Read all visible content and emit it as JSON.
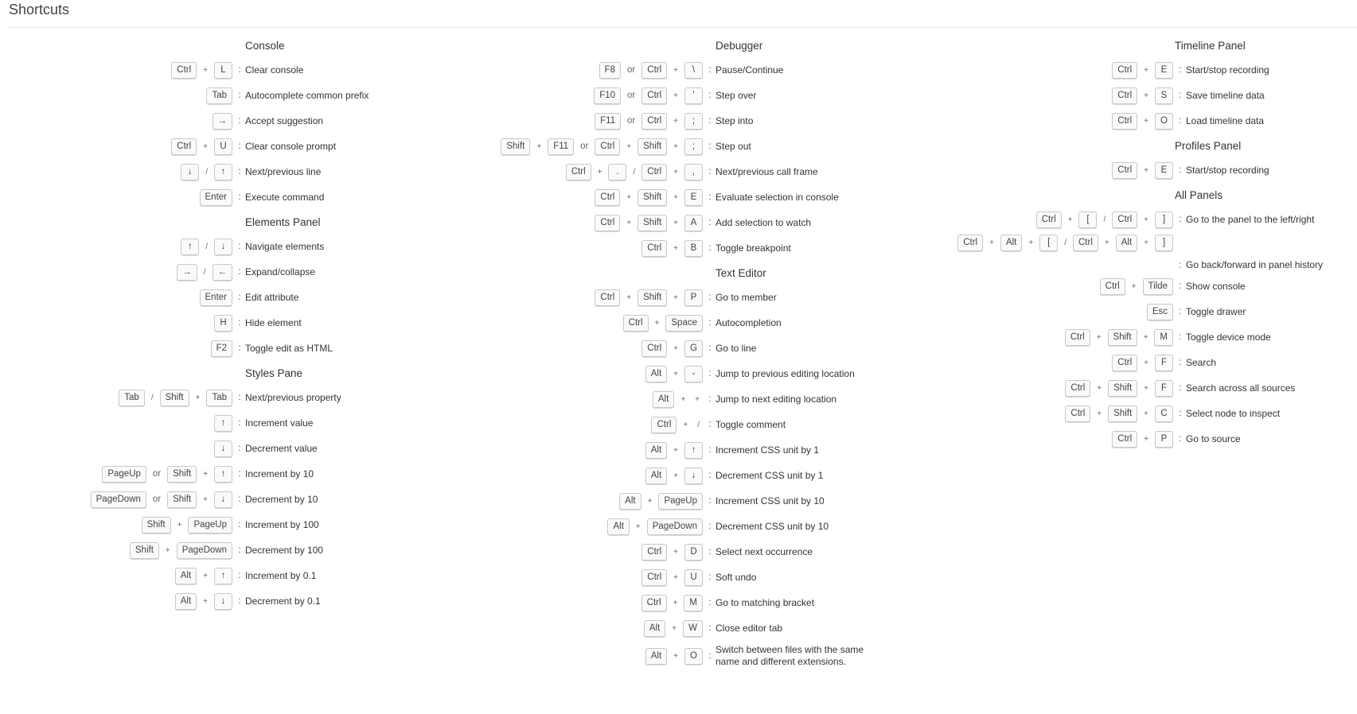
{
  "title": "Shortcuts",
  "columns": [
    {
      "sections": [
        {
          "title": "Console",
          "rows": [
            {
              "keys": [
                [
                  "Ctrl",
                  "+",
                  "L"
                ]
              ],
              "desc": "Clear console"
            },
            {
              "keys": [
                [
                  "Tab"
                ]
              ],
              "desc": "Autocomplete common prefix"
            },
            {
              "keys": [
                [
                  "→"
                ]
              ],
              "desc": "Accept suggestion"
            },
            {
              "keys": [
                [
                  "Ctrl",
                  "+",
                  "U"
                ]
              ],
              "desc": "Clear console prompt"
            },
            {
              "keys": [
                [
                  "↓",
                  "/",
                  "↑"
                ]
              ],
              "desc": "Next/previous line"
            },
            {
              "keys": [
                [
                  "Enter"
                ]
              ],
              "desc": "Execute command"
            }
          ]
        },
        {
          "title": "Elements Panel",
          "rows": [
            {
              "keys": [
                [
                  "↑",
                  "/",
                  "↓"
                ]
              ],
              "desc": "Navigate elements"
            },
            {
              "keys": [
                [
                  "→",
                  "/",
                  "←"
                ]
              ],
              "desc": "Expand/collapse"
            },
            {
              "keys": [
                [
                  "Enter"
                ]
              ],
              "desc": "Edit attribute"
            },
            {
              "keys": [
                [
                  "H"
                ]
              ],
              "desc": "Hide element"
            },
            {
              "keys": [
                [
                  "F2"
                ]
              ],
              "desc": "Toggle edit as HTML"
            }
          ]
        },
        {
          "title": "Styles Pane",
          "rows": [
            {
              "keys": [
                [
                  "Tab",
                  "/",
                  "Shift",
                  "+",
                  "Tab"
                ]
              ],
              "desc": "Next/previous property"
            },
            {
              "keys": [
                [
                  "↑"
                ]
              ],
              "desc": "Increment value"
            },
            {
              "keys": [
                [
                  "↓"
                ]
              ],
              "desc": "Decrement value"
            },
            {
              "keys": [
                [
                  "PageUp"
                ],
                [
                  "Shift",
                  "+",
                  "↑"
                ]
              ],
              "desc": "Increment by 10"
            },
            {
              "keys": [
                [
                  "PageDown"
                ],
                [
                  "Shift",
                  "+",
                  "↓"
                ]
              ],
              "desc": "Decrement by 10"
            },
            {
              "keys": [
                [
                  "Shift",
                  "+",
                  "PageUp"
                ]
              ],
              "desc": "Increment by 100"
            },
            {
              "keys": [
                [
                  "Shift",
                  "+",
                  "PageDown"
                ]
              ],
              "desc": "Decrement by 100"
            },
            {
              "keys": [
                [
                  "Alt",
                  "+",
                  "↑"
                ]
              ],
              "desc": "Increment by 0.1"
            },
            {
              "keys": [
                [
                  "Alt",
                  "+",
                  "↓"
                ]
              ],
              "desc": "Decrement by 0.1"
            }
          ]
        }
      ]
    },
    {
      "sections": [
        {
          "title": "Debugger",
          "rows": [
            {
              "keys": [
                [
                  "F8"
                ],
                [
                  "Ctrl",
                  "+",
                  "\\"
                ]
              ],
              "desc": "Pause/Continue"
            },
            {
              "keys": [
                [
                  "F10"
                ],
                [
                  "Ctrl",
                  "+",
                  "'"
                ]
              ],
              "desc": "Step over"
            },
            {
              "keys": [
                [
                  "F11"
                ],
                [
                  "Ctrl",
                  "+",
                  ";"
                ]
              ],
              "desc": "Step into"
            },
            {
              "keys": [
                [
                  "Shift",
                  "+",
                  "F11"
                ],
                [
                  "Ctrl",
                  "+",
                  "Shift",
                  "+",
                  ";"
                ]
              ],
              "desc": "Step out"
            },
            {
              "keys": [
                [
                  "Ctrl",
                  "+",
                  ".",
                  "/",
                  "Ctrl",
                  "+",
                  ","
                ]
              ],
              "desc": "Next/previous call frame"
            },
            {
              "keys": [
                [
                  "Ctrl",
                  "+",
                  "Shift",
                  "+",
                  "E"
                ]
              ],
              "desc": "Evaluate selection in console"
            },
            {
              "keys": [
                [
                  "Ctrl",
                  "+",
                  "Shift",
                  "+",
                  "A"
                ]
              ],
              "desc": "Add selection to watch"
            },
            {
              "keys": [
                [
                  "Ctrl",
                  "+",
                  "B"
                ]
              ],
              "desc": "Toggle breakpoint"
            }
          ]
        },
        {
          "title": "Text Editor",
          "rows": [
            {
              "keys": [
                [
                  "Ctrl",
                  "+",
                  "Shift",
                  "+",
                  "P"
                ]
              ],
              "desc": "Go to member"
            },
            {
              "keys": [
                [
                  "Ctrl",
                  "+",
                  "Space"
                ]
              ],
              "desc": "Autocompletion"
            },
            {
              "keys": [
                [
                  "Ctrl",
                  "+",
                  "G"
                ]
              ],
              "desc": "Go to line"
            },
            {
              "keys": [
                [
                  "Alt",
                  "+",
                  "-"
                ]
              ],
              "desc": "Jump to previous editing location"
            },
            {
              "keys": [
                [
                  "Alt",
                  "+",
                  "+"
                ]
              ],
              "desc": "Jump to next editing location"
            },
            {
              "keys": [
                [
                  "Ctrl",
                  "+",
                  "/"
                ]
              ],
              "desc": "Toggle comment"
            },
            {
              "keys": [
                [
                  "Alt",
                  "+",
                  "↑"
                ]
              ],
              "desc": "Increment CSS unit by 1"
            },
            {
              "keys": [
                [
                  "Alt",
                  "+",
                  "↓"
                ]
              ],
              "desc": "Decrement CSS unit by 1"
            },
            {
              "keys": [
                [
                  "Alt",
                  "+",
                  "PageUp"
                ]
              ],
              "desc": "Increment CSS unit by 10"
            },
            {
              "keys": [
                [
                  "Alt",
                  "+",
                  "PageDown"
                ]
              ],
              "desc": "Decrement CSS unit by 10"
            },
            {
              "keys": [
                [
                  "Ctrl",
                  "+",
                  "D"
                ]
              ],
              "desc": "Select next occurrence"
            },
            {
              "keys": [
                [
                  "Ctrl",
                  "+",
                  "U"
                ]
              ],
              "desc": "Soft undo"
            },
            {
              "keys": [
                [
                  "Ctrl",
                  "+",
                  "M"
                ]
              ],
              "desc": "Go to matching bracket"
            },
            {
              "keys": [
                [
                  "Alt",
                  "+",
                  "W"
                ]
              ],
              "desc": "Close editor tab"
            },
            {
              "keys": [
                [
                  "Alt",
                  "+",
                  "O"
                ]
              ],
              "desc": "Switch between files with the same name and different extensions."
            }
          ]
        }
      ]
    },
    {
      "sections": [
        {
          "title": "Timeline Panel",
          "rows": [
            {
              "keys": [
                [
                  "Ctrl",
                  "+",
                  "E"
                ]
              ],
              "desc": "Start/stop recording"
            },
            {
              "keys": [
                [
                  "Ctrl",
                  "+",
                  "S"
                ]
              ],
              "desc": "Save timeline data"
            },
            {
              "keys": [
                [
                  "Ctrl",
                  "+",
                  "O"
                ]
              ],
              "desc": "Load timeline data"
            }
          ]
        },
        {
          "title": "Profiles Panel",
          "rows": [
            {
              "keys": [
                [
                  "Ctrl",
                  "+",
                  "E"
                ]
              ],
              "desc": "Start/stop recording"
            }
          ]
        },
        {
          "title": "All Panels",
          "rows": [
            {
              "keys": [
                [
                  "Ctrl",
                  "+",
                  "[",
                  "/",
                  "Ctrl",
                  "+",
                  "]"
                ]
              ],
              "desc": "Go to the panel to the left/right"
            },
            {
              "keys": [
                [
                  "Ctrl",
                  "+",
                  "Alt",
                  "+",
                  "[",
                  "/",
                  "Ctrl",
                  "+",
                  "Alt",
                  "+",
                  "]"
                ]
              ],
              "desc": "Go back/forward in panel history",
              "wrap": true
            },
            {
              "keys": [
                [
                  "Ctrl",
                  "+",
                  "Tilde"
                ]
              ],
              "desc": "Show console"
            },
            {
              "keys": [
                [
                  "Esc"
                ]
              ],
              "desc": "Toggle drawer"
            },
            {
              "keys": [
                [
                  "Ctrl",
                  "+",
                  "Shift",
                  "+",
                  "M"
                ]
              ],
              "desc": "Toggle device mode"
            },
            {
              "keys": [
                [
                  "Ctrl",
                  "+",
                  "F"
                ]
              ],
              "desc": "Search"
            },
            {
              "keys": [
                [
                  "Ctrl",
                  "+",
                  "Shift",
                  "+",
                  "F"
                ]
              ],
              "desc": "Search across all sources"
            },
            {
              "keys": [
                [
                  "Ctrl",
                  "+",
                  "Shift",
                  "+",
                  "C"
                ]
              ],
              "desc": "Select node to inspect"
            },
            {
              "keys": [
                [
                  "Ctrl",
                  "+",
                  "P"
                ]
              ],
              "desc": "Go to source"
            }
          ]
        }
      ]
    }
  ],
  "or_label": "or",
  "colon": ":"
}
